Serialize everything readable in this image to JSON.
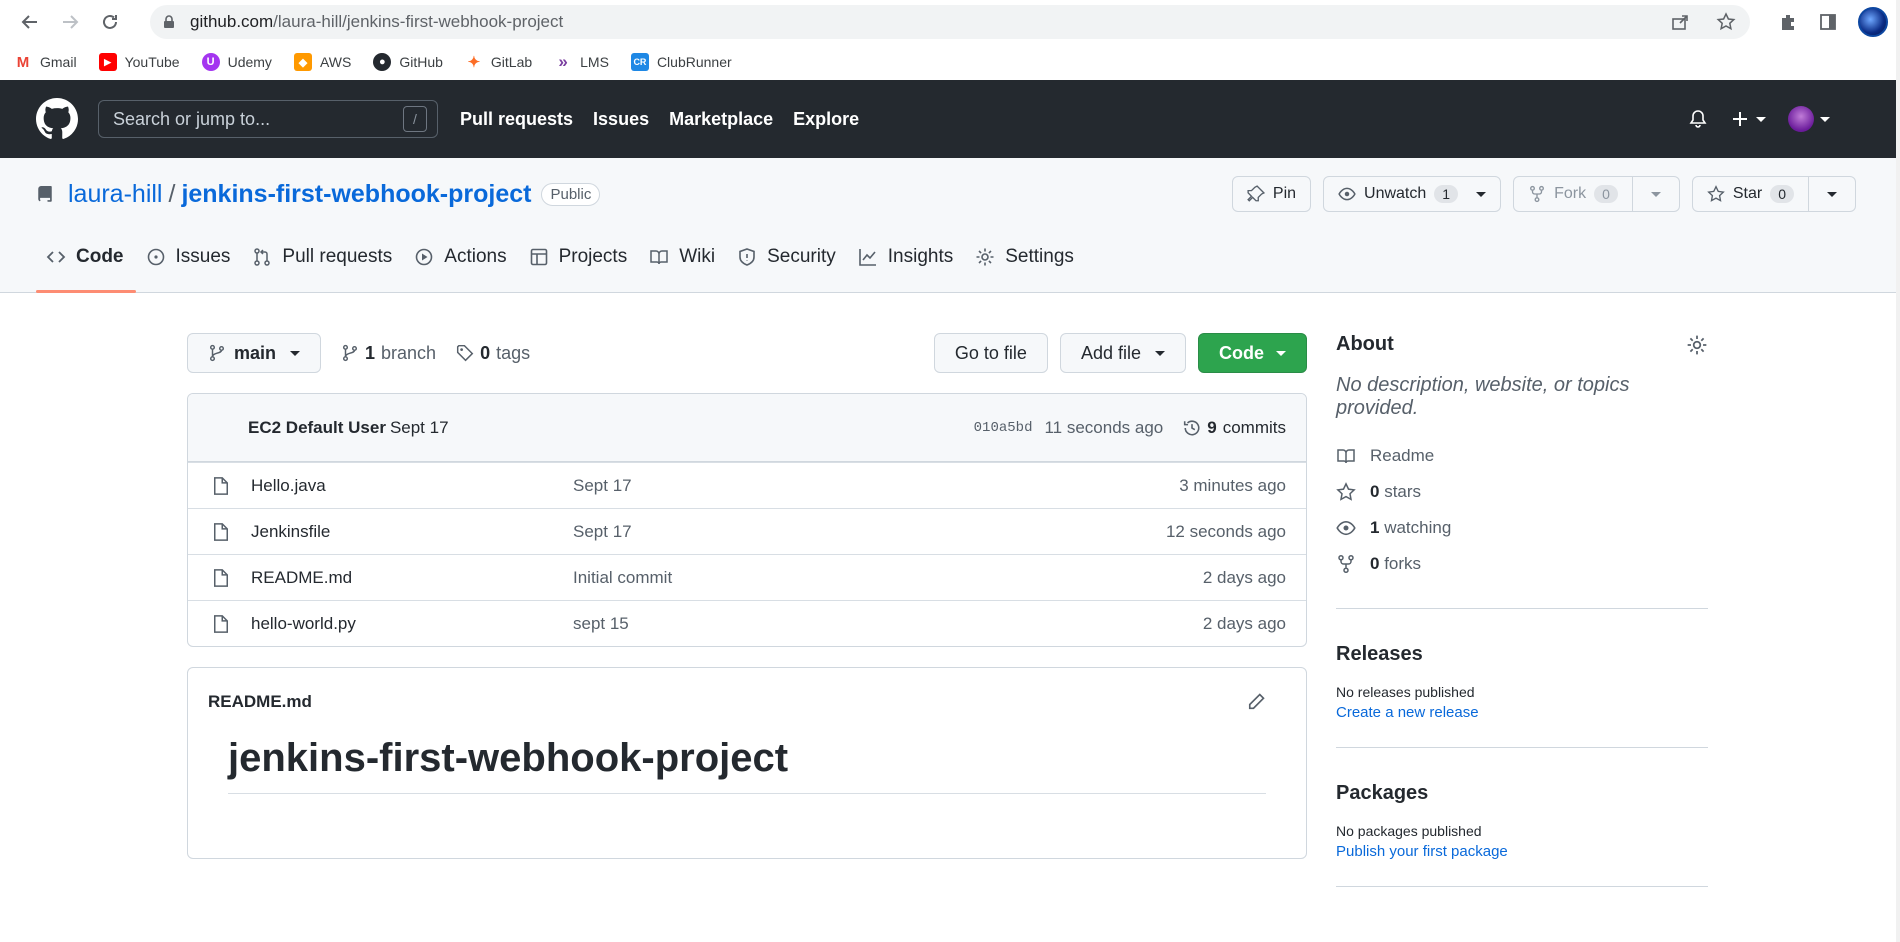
{
  "browser": {
    "url_host": "github.com",
    "url_path": "/laura-hill/jenkins-first-webhook-project",
    "bookmarks": [
      {
        "label": "Gmail",
        "color": "#ea4335",
        "glyph": "M"
      },
      {
        "label": "YouTube",
        "color": "#ff0000",
        "glyph": "▶"
      },
      {
        "label": "Udemy",
        "color": "#a435f0",
        "glyph": "U"
      },
      {
        "label": "AWS",
        "color": "#ff9900",
        "glyph": "◆"
      },
      {
        "label": "GitHub",
        "color": "#24292f",
        "glyph": "●"
      },
      {
        "label": "GitLab",
        "color": "#fc6d26",
        "glyph": "✦"
      },
      {
        "label": "LMS",
        "color": "#7b3fa0",
        "glyph": "»"
      },
      {
        "label": "ClubRunner",
        "color": "#1e88e5",
        "glyph": "CR"
      }
    ]
  },
  "header": {
    "search_placeholder": "Search or jump to...",
    "search_shortcut": "/",
    "nav": [
      "Pull requests",
      "Issues",
      "Marketplace",
      "Explore"
    ]
  },
  "repo": {
    "owner": "laura-hill",
    "separator": "/",
    "name": "jenkins-first-webhook-project",
    "visibility": "Public",
    "pin_label": "Pin",
    "unwatch_label": "Unwatch",
    "unwatch_count": "1",
    "fork_label": "Fork",
    "fork_count": "0",
    "star_label": "Star",
    "star_count": "0",
    "tabs": [
      "Code",
      "Issues",
      "Pull requests",
      "Actions",
      "Projects",
      "Wiki",
      "Security",
      "Insights",
      "Settings"
    ]
  },
  "filenav": {
    "branch": "main",
    "branch_count": "1",
    "branch_word": "branch",
    "tag_count": "0",
    "tag_word": "tags",
    "go_to_file": "Go to file",
    "add_file": "Add file",
    "code": "Code"
  },
  "commit": {
    "author": "EC2 Default User",
    "message": "Sept 17",
    "sha": "010a5bd",
    "time": "11 seconds ago",
    "commit_count": "9",
    "commit_word": "commits"
  },
  "files": [
    {
      "name": "Hello.java",
      "message": "Sept 17",
      "time": "3 minutes ago"
    },
    {
      "name": "Jenkinsfile",
      "message": "Sept 17",
      "time": "12 seconds ago"
    },
    {
      "name": "README.md",
      "message": "Initial commit",
      "time": "2 days ago"
    },
    {
      "name": "hello-world.py",
      "message": "sept 15",
      "time": "2 days ago"
    }
  ],
  "readme": {
    "filename": "README.md",
    "heading": "jenkins-first-webhook-project"
  },
  "sidebar": {
    "about_title": "About",
    "description": "No description, website, or topics provided.",
    "readme_label": "Readme",
    "stars_count": "0",
    "stars_word": "stars",
    "watching_count": "1",
    "watching_word": "watching",
    "forks_count": "0",
    "forks_word": "forks",
    "releases_title": "Releases",
    "releases_sub": "No releases published",
    "releases_link": "Create a new release",
    "packages_title": "Packages",
    "packages_sub": "No packages published",
    "packages_link": "Publish your first package"
  }
}
